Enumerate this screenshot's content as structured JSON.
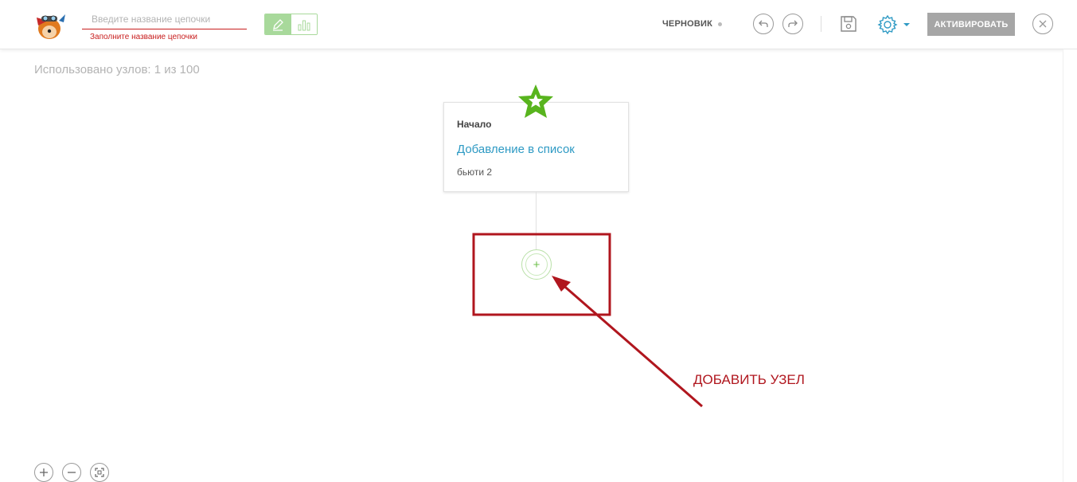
{
  "header": {
    "name_input": {
      "placeholder": "Введите название цепочки",
      "value": ""
    },
    "name_error": "Заполните название цепочки",
    "status_label": "ЧЕРНОВИК",
    "activate_label": "АКТИВИРОВАТЬ",
    "mode_toggle": {
      "active": "edit-mode",
      "options": [
        "edit-mode",
        "stats-mode"
      ]
    }
  },
  "canvas": {
    "usage": "Использовано узлов: 1 из 100",
    "start_node": {
      "label": "Начало",
      "title": "Добавление в список",
      "subtitle": "бьюти 2"
    }
  },
  "annotation": {
    "text": "ДОБАВИТЬ УЗЕЛ",
    "color": "#b0161e"
  },
  "colors": {
    "accent_green": "#6cbf4a",
    "link_blue": "#2e9ac4",
    "error_red": "#c81e1e",
    "settings_blue": "#2e9ac4"
  },
  "icons": [
    "logo-icon",
    "pencil-icon",
    "bar-chart-icon",
    "undo-icon",
    "redo-icon",
    "save-icon",
    "gear-icon",
    "caret-down-icon",
    "close-icon",
    "star-icon",
    "plus-icon",
    "zoom-in-icon",
    "zoom-out-icon",
    "fit-screen-icon"
  ]
}
